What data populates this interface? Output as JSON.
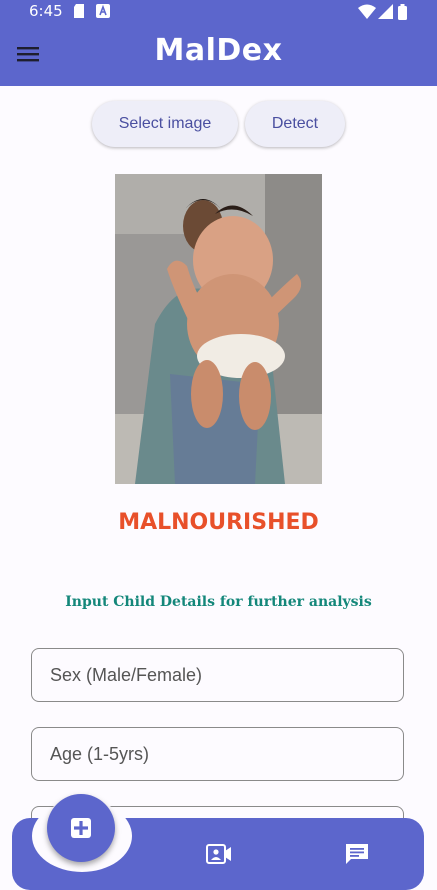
{
  "status_bar": {
    "time": "6:45"
  },
  "app_bar": {
    "title": "MalDex"
  },
  "actions": {
    "select_image_label": "Select image",
    "detect_label": "Detect"
  },
  "result": {
    "label": "MALNOURISHED"
  },
  "form": {
    "instruction": "Input Child Details for further analysis",
    "sex_placeholder": "Sex  (Male/Female)",
    "age_placeholder": "Age (1-5yrs)"
  },
  "colors": {
    "primary": "#5c66cc",
    "result": "#e8502a",
    "instruction": "#14877a",
    "button_bg": "#eeeef8"
  },
  "icons": [
    "menu-icon",
    "medical-plus-icon",
    "video-contact-icon",
    "chat-icon",
    "sd-card-icon",
    "a-badge-icon",
    "wifi-icon",
    "signal-icon",
    "battery-icon"
  ]
}
